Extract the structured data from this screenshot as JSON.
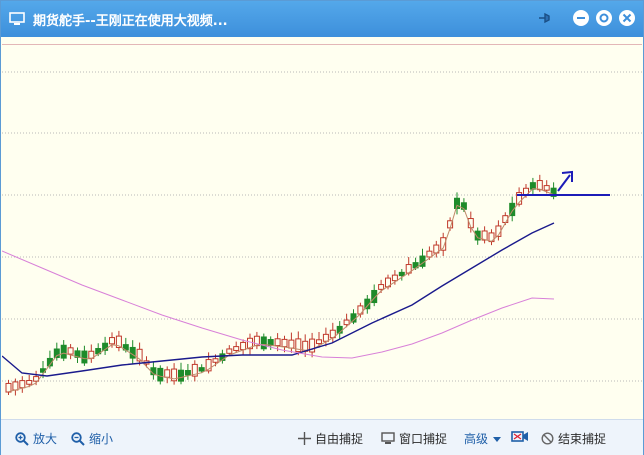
{
  "window": {
    "title": "期货舵手--王刚正在使用大视频...",
    "accent": "#3d8fdb"
  },
  "toolbar": {
    "zoom_in_label": "放大",
    "zoom_out_label": "缩小",
    "free_capture_label": "自由捕捉",
    "window_capture_label": "窗口捕捉",
    "advanced_label": "高级",
    "end_capture_label": "结束捕捉"
  },
  "icons": [
    "monitor-icon",
    "pin-icon",
    "minimize-icon",
    "restore-icon",
    "close-icon",
    "zoom-in-icon",
    "zoom-out-icon",
    "crosshair-icon",
    "window-capture-icon",
    "caret-down-icon",
    "camera-icon",
    "stop-icon"
  ],
  "chart_data": {
    "type": "candlestick",
    "bull_color": "#c0392b",
    "bear_color": "#1e8b2a",
    "ma_colors": [
      "#c08a6a",
      "#1a1a8c",
      "#d880d8"
    ],
    "annotation_color": "#1c1cb8"
  }
}
